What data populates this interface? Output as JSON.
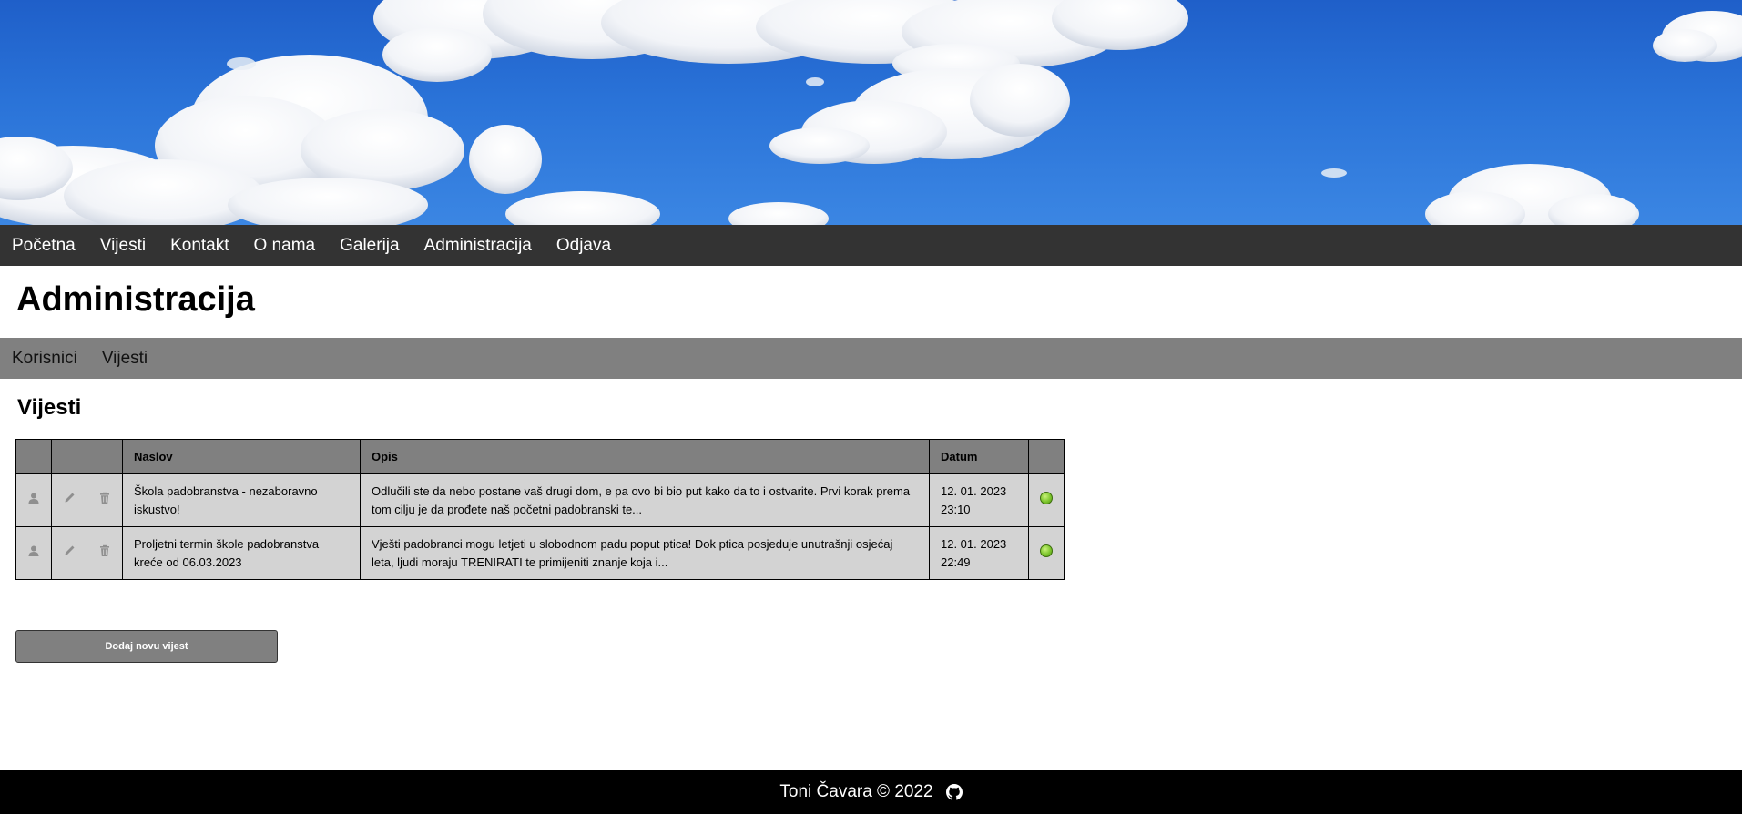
{
  "nav": {
    "items": [
      {
        "label": "Početna"
      },
      {
        "label": "Vijesti"
      },
      {
        "label": "Kontakt"
      },
      {
        "label": "O nama"
      },
      {
        "label": "Galerija"
      },
      {
        "label": "Administracija"
      },
      {
        "label": "Odjava"
      }
    ]
  },
  "page": {
    "title": "Administracija"
  },
  "subnav": {
    "items": [
      {
        "label": "Korisnici"
      },
      {
        "label": "Vijesti"
      }
    ]
  },
  "section": {
    "title": "Vijesti"
  },
  "table": {
    "headers": {
      "title": "Naslov",
      "description": "Opis",
      "date": "Datum"
    },
    "rows": [
      {
        "title": "Škola padobranstva - nezaboravno iskustvo!",
        "description": "Odlučili ste da nebo postane vaš drugi dom, e pa ovo bi bio put kako da to i ostvarite. Prvi korak prema tom cilju je da prođete naš početni padobranski te...",
        "date": "12. 01. 2023 23:10",
        "status": "active"
      },
      {
        "title": "Proljetni termin škole padobranstva kreće od 06.03.2023",
        "description": "Vješti padobranci mogu letjeti u slobodnom padu poput ptica! Dok ptica posjeduje unutrašnji osjećaj leta, ljudi moraju TRENIRATI te primijeniti znanje koja i...",
        "date": "12. 01. 2023 22:49",
        "status": "active"
      }
    ],
    "row_icons": [
      "user-icon",
      "pencil-icon",
      "trash-icon"
    ]
  },
  "actions": {
    "add_label": "Dodaj novu vijest"
  },
  "footer": {
    "text": "Toni Čavara © 2022",
    "icon": "github-icon"
  },
  "colors": {
    "nav_bg": "#333333",
    "subnav_bg": "#808080",
    "footer_bg": "#000000",
    "table_bg": "#d3d3d3",
    "status_green": "#7dc62d"
  }
}
